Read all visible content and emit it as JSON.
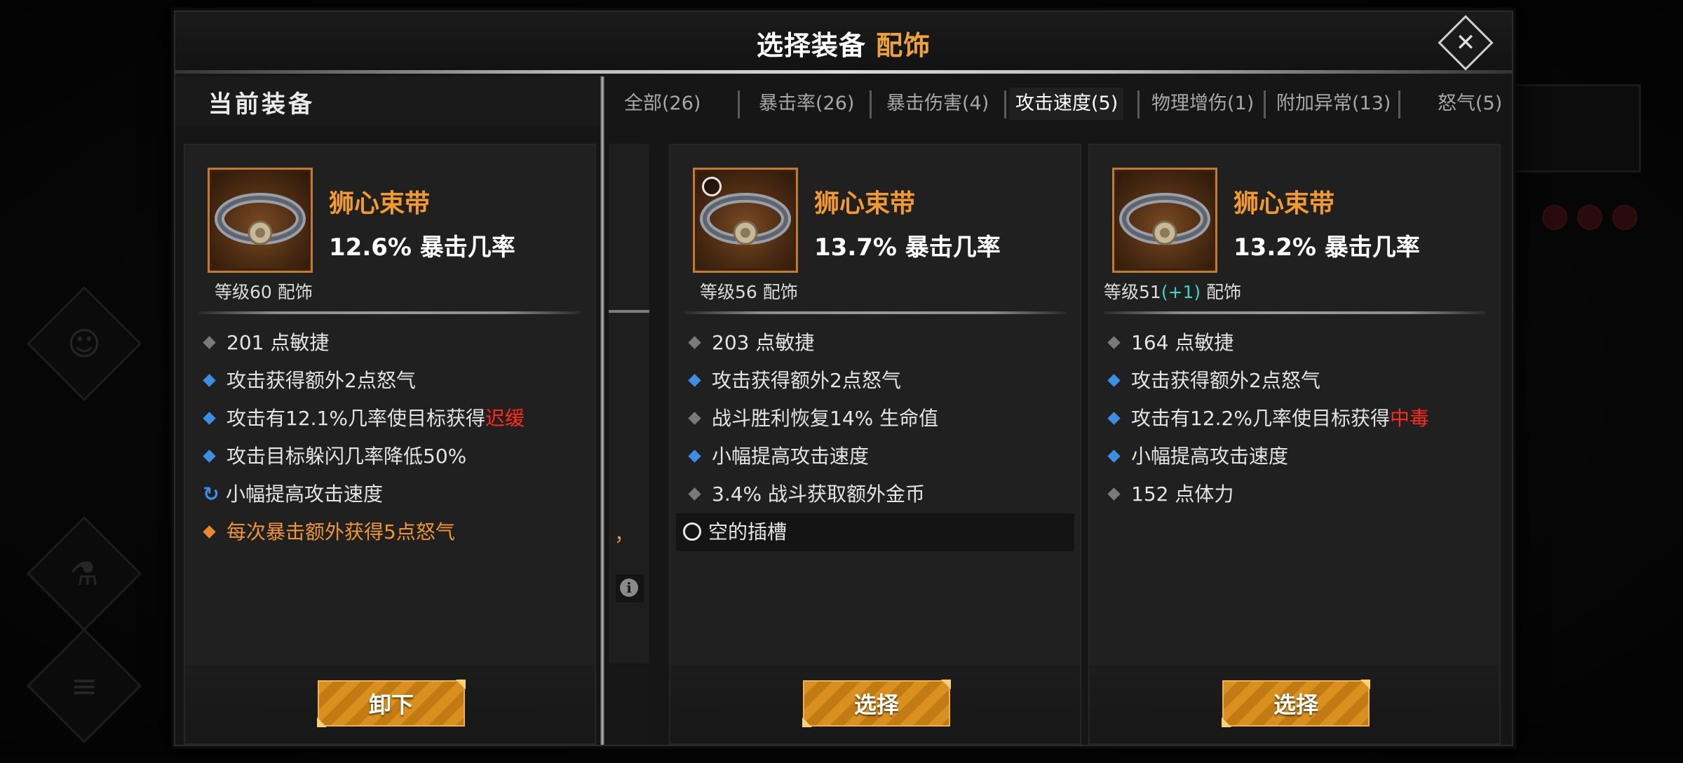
{
  "header": {
    "title": "选择装备",
    "category": "配饰",
    "close_glyph": "✕"
  },
  "left_panel": {
    "heading": "当前装备"
  },
  "tabs": [
    {
      "label": "全部(26)",
      "active": false
    },
    {
      "label": "暴击率(26)",
      "active": false
    },
    {
      "label": "暴击伤害(4)",
      "active": false
    },
    {
      "label": "攻击速度(5)",
      "active": true
    },
    {
      "label": "物理增伤(1)",
      "active": false
    },
    {
      "label": "附加异常(13)",
      "active": false
    },
    {
      "label": "怒气(5)",
      "active": false
    }
  ],
  "peek_card": {
    "fragment": "，",
    "info_glyph": "i"
  },
  "cards": [
    {
      "name": "狮心束带",
      "stat": "12.6% 暴击几率",
      "level": "等级60",
      "level_bonus": "",
      "type": "配饰",
      "attrs": [
        {
          "text": "201 点敏捷",
          "bullet": "gray"
        },
        {
          "text": "攻击获得额外2点怒气",
          "bullet": "blue"
        },
        {
          "text": "攻击有12.1%几率使目标获得",
          "highlight": "迟缓",
          "bullet": "blue"
        },
        {
          "text": "攻击目标躲闪几率降低50%",
          "bullet": "blue"
        },
        {
          "text": "小幅提高攻击速度",
          "bullet": "cycle",
          "glyph": "↻"
        },
        {
          "text": "每次暴击额外获得5点怒气",
          "bullet": "orange"
        }
      ],
      "button": "卸下"
    },
    {
      "name": "狮心束带",
      "stat": "13.7% 暴击几率",
      "level": "等级56",
      "level_bonus": "",
      "type": "配饰",
      "attrs": [
        {
          "text": "203 点敏捷",
          "bullet": "gray"
        },
        {
          "text": "攻击获得额外2点怒气",
          "bullet": "blue"
        },
        {
          "text": "战斗胜利恢复14% 生命值",
          "bullet": "gray"
        },
        {
          "text": "小幅提高攻击速度",
          "bullet": "blue"
        },
        {
          "text": "3.4% 战斗获取额外金币",
          "bullet": "gray"
        },
        {
          "text": "空的插槽",
          "bullet": "ring"
        }
      ],
      "button": "选择"
    },
    {
      "name": "狮心束带",
      "stat": "13.2% 暴击几率",
      "level": "等级51",
      "level_bonus": "(+1)",
      "type": "配饰",
      "attrs": [
        {
          "text": "164 点敏捷",
          "bullet": "gray"
        },
        {
          "text": "攻击获得额外2点怒气",
          "bullet": "blue"
        },
        {
          "text": "攻击有12.2%几率使目标获得",
          "highlight": "中毒",
          "bullet": "blue"
        },
        {
          "text": "小幅提高攻击速度",
          "bullet": "blue"
        },
        {
          "text": "152 点体力",
          "bullet": "gray"
        }
      ],
      "button": "选择"
    }
  ],
  "colors": {
    "accent_orange": "#f0a23a",
    "item_name": "#f39a2e",
    "debuff_red": "#ff2a1a",
    "level_bonus": "#3fd3c4",
    "bullet_blue": "#3b8fe4"
  }
}
